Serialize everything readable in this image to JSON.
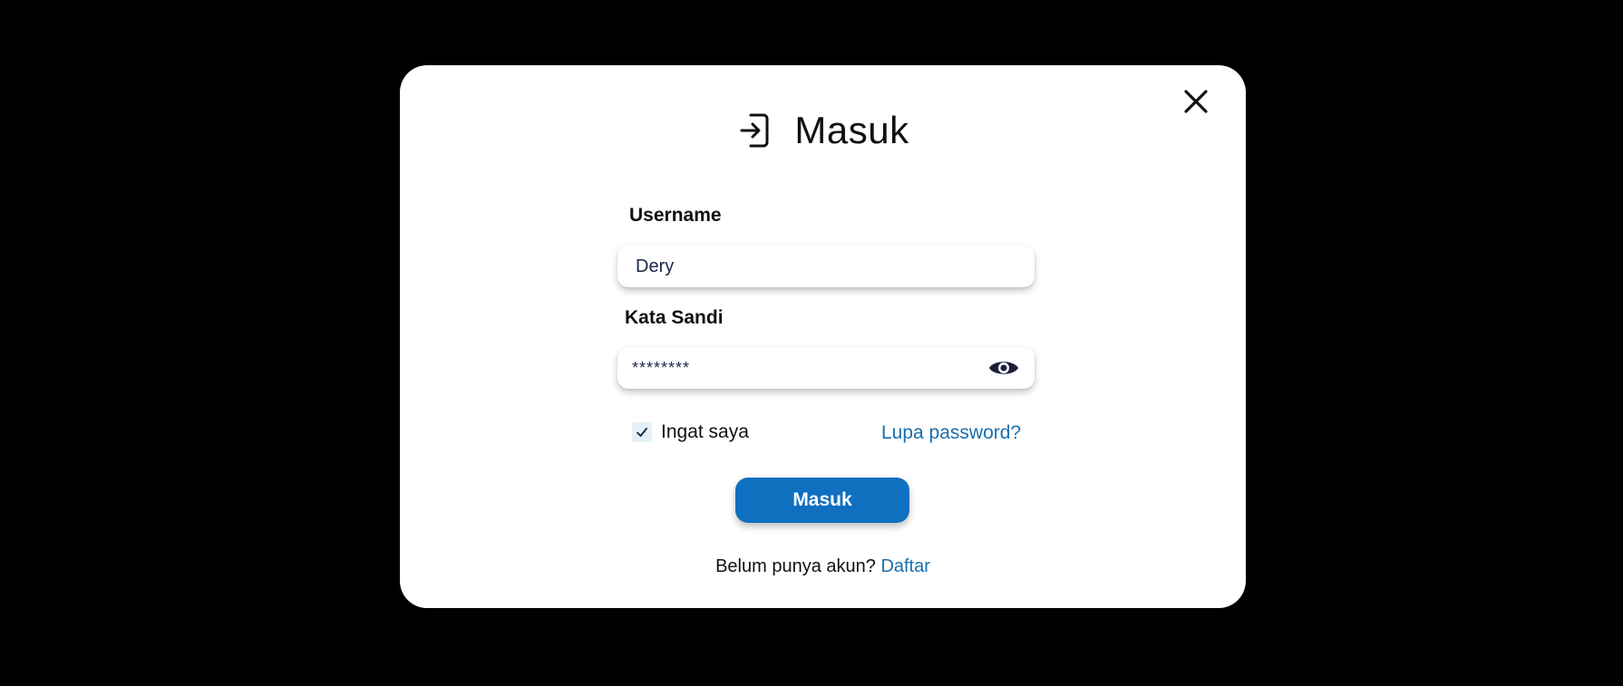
{
  "modal": {
    "title": "Masuk",
    "icons": {
      "header": "login-icon",
      "close": "close-icon",
      "password_toggle": "eye-icon",
      "checkbox": "check-icon"
    }
  },
  "form": {
    "username": {
      "label": "Username",
      "value": "Dery"
    },
    "password": {
      "label": "Kata Sandi",
      "value": "********"
    },
    "remember": {
      "label": "Ingat saya",
      "checked": true
    },
    "forgot_label": "Lupa password?",
    "submit_label": "Masuk"
  },
  "footer": {
    "prompt": "Belum punya akun?",
    "link_label": "Daftar"
  },
  "colors": {
    "background": "#000000",
    "modal": "#ffffff",
    "primary_button": "#0f70c0",
    "link": "#1a6fad",
    "icon_dark": "#1b1f3b"
  }
}
